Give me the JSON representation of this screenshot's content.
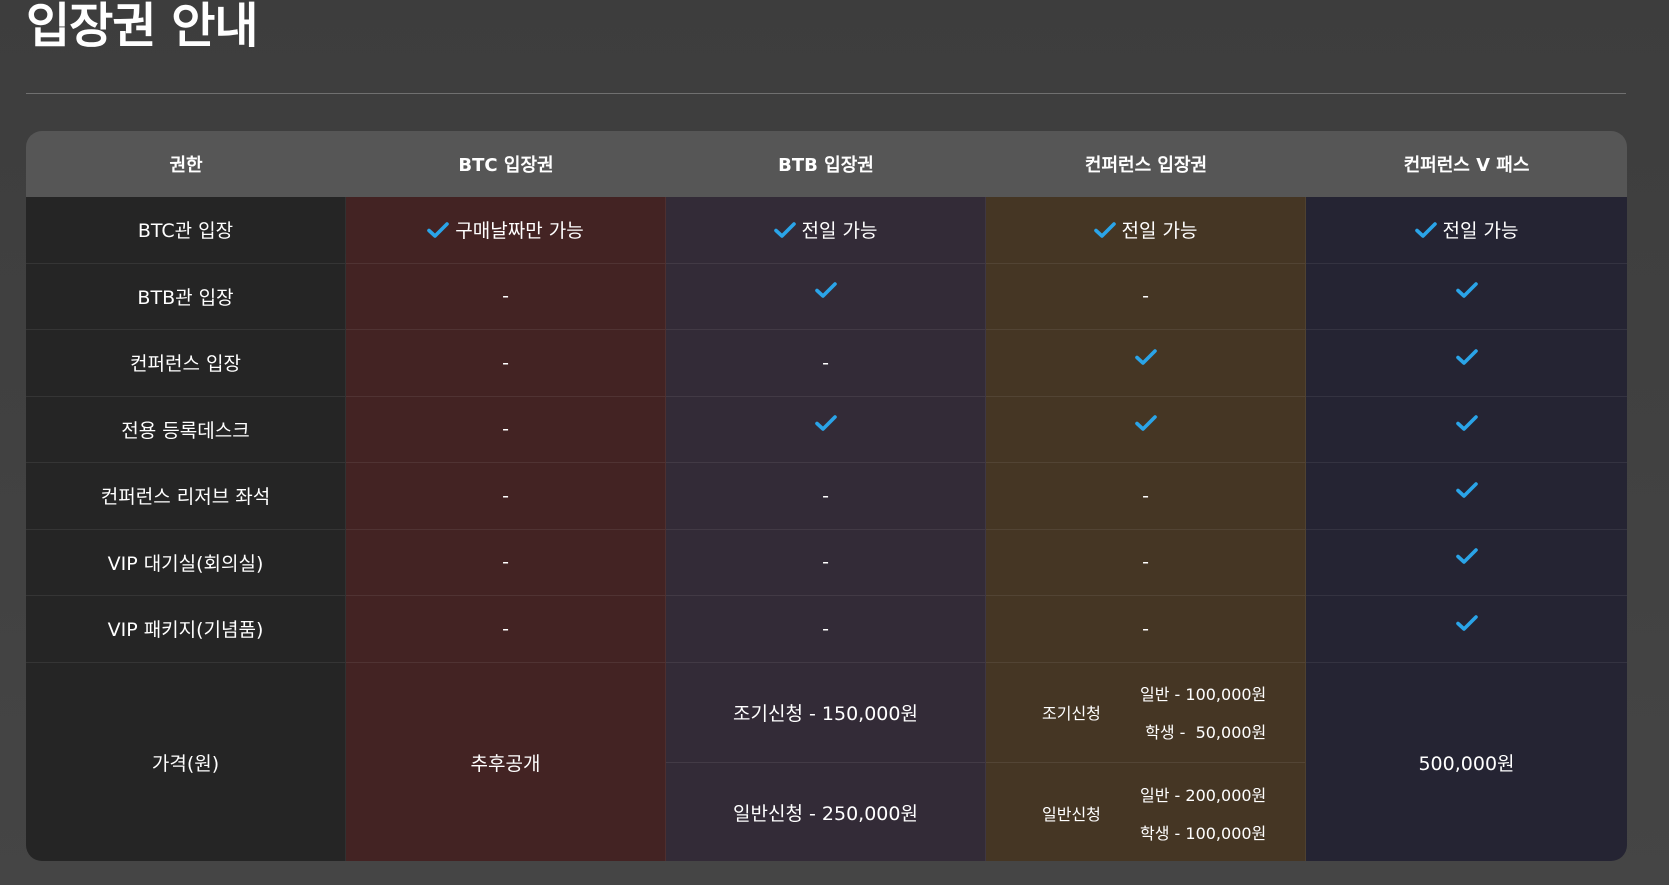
{
  "page": {
    "title": "입장권 안내"
  },
  "headers": [
    "권한",
    "BTC 입장권",
    "BTB 입장권",
    "컨퍼런스 입장권",
    "컨퍼런스 V 패스"
  ],
  "rows": [
    {
      "label": "BTC관 입장",
      "cells": [
        {
          "check": true,
          "text": "구매날짜만 가능"
        },
        {
          "check": true,
          "text": "전일 가능"
        },
        {
          "check": true,
          "text": "전일 가능"
        },
        {
          "check": true,
          "text": "전일 가능"
        }
      ]
    },
    {
      "label": "BTB관 입장",
      "cells": [
        {
          "check": false,
          "text": "-"
        },
        {
          "check": true,
          "text": ""
        },
        {
          "check": false,
          "text": "-"
        },
        {
          "check": true,
          "text": ""
        }
      ]
    },
    {
      "label": "컨퍼런스 입장",
      "cells": [
        {
          "check": false,
          "text": "-"
        },
        {
          "check": false,
          "text": "-"
        },
        {
          "check": true,
          "text": ""
        },
        {
          "check": true,
          "text": ""
        }
      ]
    },
    {
      "label": "전용 등록데스크",
      "cells": [
        {
          "check": false,
          "text": "-"
        },
        {
          "check": true,
          "text": ""
        },
        {
          "check": true,
          "text": ""
        },
        {
          "check": true,
          "text": ""
        }
      ]
    },
    {
      "label": "컨퍼런스 리저브 좌석",
      "cells": [
        {
          "check": false,
          "text": "-"
        },
        {
          "check": false,
          "text": "-"
        },
        {
          "check": false,
          "text": "-"
        },
        {
          "check": true,
          "text": ""
        }
      ]
    },
    {
      "label": "VIP 대기실(회의실)",
      "cells": [
        {
          "check": false,
          "text": "-"
        },
        {
          "check": false,
          "text": "-"
        },
        {
          "check": false,
          "text": "-"
        },
        {
          "check": true,
          "text": ""
        }
      ]
    },
    {
      "label": "VIP 패키지(기념품)",
      "cells": [
        {
          "check": false,
          "text": "-"
        },
        {
          "check": false,
          "text": "-"
        },
        {
          "check": false,
          "text": "-"
        },
        {
          "check": true,
          "text": ""
        }
      ]
    }
  ],
  "price": {
    "label": "가격(원)",
    "btc": "추후공개",
    "btb_early": "조기신청 - 150,000원",
    "btb_general": "일반신청 - 250,000원",
    "conf_early_label": "조기신청",
    "conf_early_general": "일반 - 100,000원",
    "conf_early_student": "학생 -  50,000원",
    "conf_general_label": "일반신청",
    "conf_general_general": "일반 - 200,000원",
    "conf_general_student": "학생 - 100,000원",
    "vpass": "500,000원"
  },
  "colors": {
    "check": "#2aa4e8",
    "btc_col": "#432323",
    "btb_col": "#332b37",
    "conf_col": "#453624",
    "vpass_col": "#252433",
    "header_bg": "#565656"
  }
}
